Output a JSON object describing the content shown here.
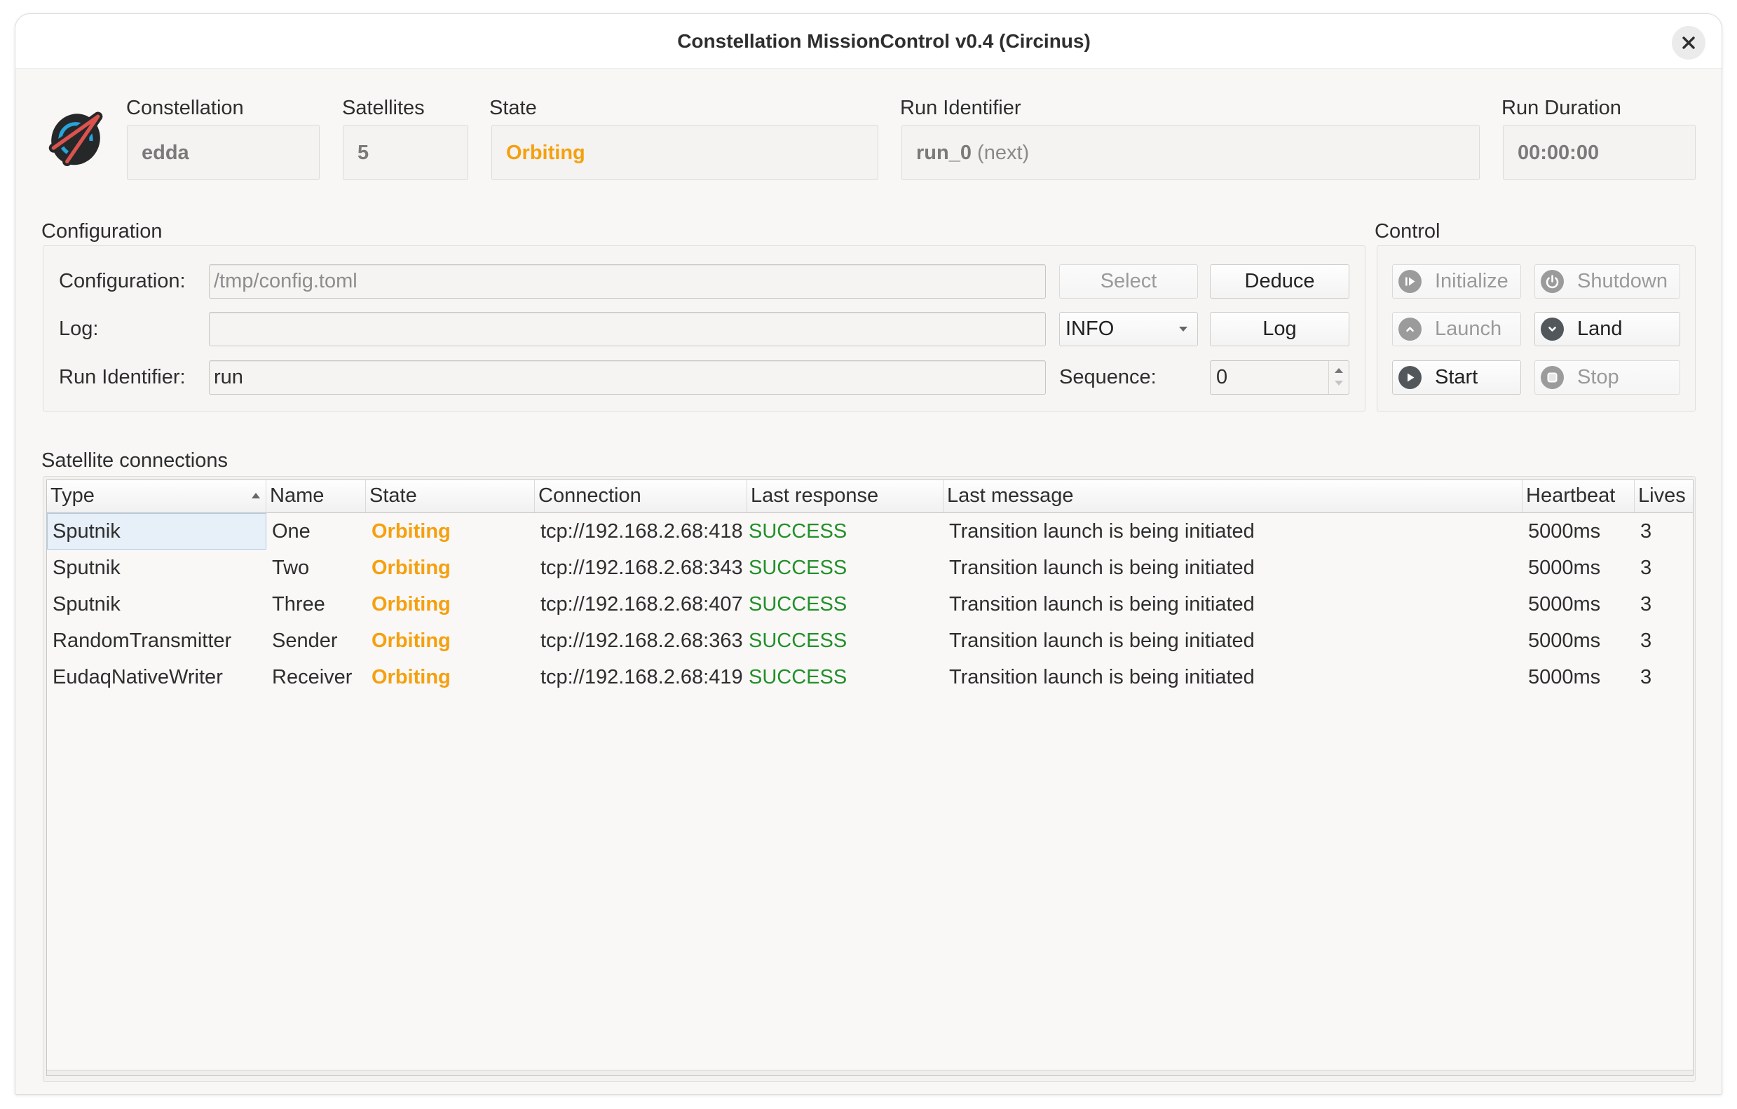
{
  "window": {
    "title": "Constellation MissionControl v0.4 (Circinus)",
    "close_icon": "close-icon"
  },
  "header": {
    "logo": "constellation-logo-icon",
    "constellation": {
      "label": "Constellation",
      "value": "edda"
    },
    "satellites": {
      "label": "Satellites",
      "value": "5"
    },
    "state": {
      "label": "State",
      "value": "Orbiting"
    },
    "run_identifier": {
      "label": "Run Identifier",
      "value": "run_0",
      "suffix": "(next)"
    },
    "run_duration": {
      "label": "Run Duration",
      "value": "00:00:00"
    }
  },
  "configuration": {
    "title": "Configuration",
    "config_file": {
      "label": "Configuration:",
      "value": "",
      "placeholder": "/tmp/config.toml"
    },
    "select_button": {
      "label": "Select",
      "enabled": false
    },
    "deduce_button": {
      "label": "Deduce",
      "enabled": true
    },
    "log": {
      "label": "Log:",
      "value": ""
    },
    "log_level": {
      "selected": "INFO"
    },
    "log_button": {
      "label": "Log",
      "enabled": true
    },
    "run_identifier": {
      "label": "Run Identifier:",
      "value": "run"
    },
    "sequence": {
      "label": "Sequence:",
      "value": "0"
    }
  },
  "control": {
    "title": "Control",
    "buttons": {
      "initialize": {
        "label": "Initialize",
        "icon": "initialize-icon",
        "enabled": false
      },
      "shutdown": {
        "label": "Shutdown",
        "icon": "power-icon",
        "enabled": false
      },
      "launch": {
        "label": "Launch",
        "icon": "chevron-up-icon",
        "enabled": false
      },
      "land": {
        "label": "Land",
        "icon": "chevron-down-icon",
        "enabled": true
      },
      "start": {
        "label": "Start",
        "icon": "play-icon",
        "enabled": true
      },
      "stop": {
        "label": "Stop",
        "icon": "stop-icon",
        "enabled": false
      }
    }
  },
  "satellites": {
    "title": "Satellite connections",
    "sort": {
      "column": "Type",
      "order": "ascending"
    },
    "selected_cell": {
      "row": 0,
      "column": "Type"
    },
    "columns": {
      "type": "Type",
      "name": "Name",
      "state": "State",
      "connection": "Connection",
      "last_response": "Last response",
      "last_message": "Last message",
      "heartbeat": "Heartbeat",
      "lives": "Lives"
    },
    "rows": [
      {
        "type": "Sputnik",
        "name": "One",
        "state": "Orbiting",
        "connection": "tcp://192.168.2.68:418",
        "last_response": "SUCCESS",
        "last_message": "Transition launch is being initiated",
        "heartbeat": "5000ms",
        "lives": "3"
      },
      {
        "type": "Sputnik",
        "name": "Two",
        "state": "Orbiting",
        "connection": "tcp://192.168.2.68:343",
        "last_response": "SUCCESS",
        "last_message": "Transition launch is being initiated",
        "heartbeat": "5000ms",
        "lives": "3"
      },
      {
        "type": "Sputnik",
        "name": "Three",
        "state": "Orbiting",
        "connection": "tcp://192.168.2.68:407",
        "last_response": "SUCCESS",
        "last_message": "Transition launch is being initiated",
        "heartbeat": "5000ms",
        "lives": "3"
      },
      {
        "type": "RandomTransmitter",
        "name": "Sender",
        "state": "Orbiting",
        "connection": "tcp://192.168.2.68:363",
        "last_response": "SUCCESS",
        "last_message": "Transition launch is being initiated",
        "heartbeat": "5000ms",
        "lives": "3"
      },
      {
        "type": "EudaqNativeWriter",
        "name": "Receiver",
        "state": "Orbiting",
        "connection": "tcp://192.168.2.68:419",
        "last_response": "SUCCESS",
        "last_message": "Transition launch is being initiated",
        "heartbeat": "5000ms",
        "lives": "3"
      }
    ]
  },
  "colors": {
    "orange": "#f5a00f",
    "green": "#23902a",
    "blue": "#29a3db",
    "red": "#d9534f"
  }
}
